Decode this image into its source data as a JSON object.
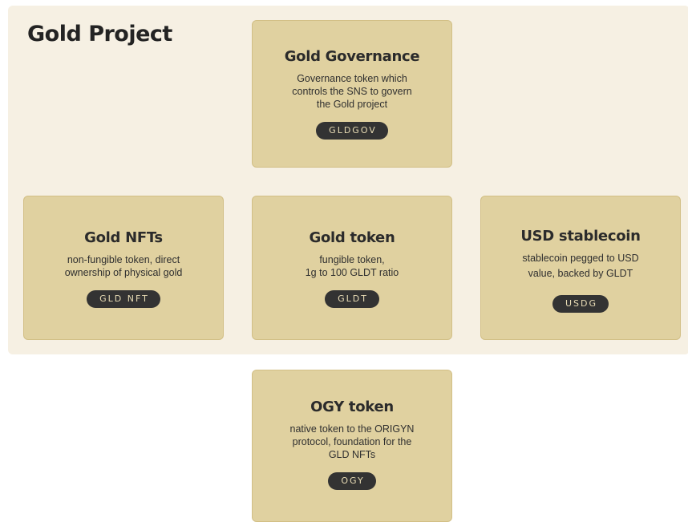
{
  "diagram": {
    "title": "Gold Project",
    "cards": {
      "gldgov": {
        "title": "Gold Governance",
        "description": "Governance token which\ncontrols the SNS to govern\nthe Gold project",
        "badge": "GLDGOV"
      },
      "nft": {
        "title": "Gold NFTs",
        "description": "non-fungible token, direct\nownership of physical gold",
        "badge": "GLD NFT"
      },
      "gldt": {
        "title": "Gold token",
        "description": "fungible token,\n1g to 100 GLDT ratio",
        "badge": "GLDT"
      },
      "usdg": {
        "title": "USD stablecoin",
        "description": "stablecoin pegged to USD\nvalue, backed by GLDT",
        "badge": "USDG"
      },
      "ogy": {
        "title": "OGY token",
        "description": "native token to the ORIGYN\nprotocol, foundation for the\nGLD NFTs",
        "badge": "OGY"
      }
    }
  },
  "colors": {
    "panel_background": "#f6f0e3",
    "card_background": "#e0d1a0",
    "badge_background": "#333333",
    "badge_text": "#e8dcb5"
  }
}
